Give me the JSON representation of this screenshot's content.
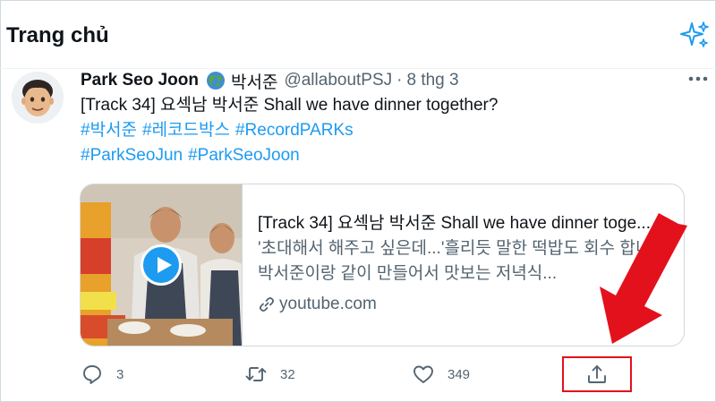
{
  "header": {
    "title": "Trang chủ",
    "sparkle_icon": "sparkle-icon"
  },
  "tweet": {
    "author_name": "Park Seo Joon",
    "author_korean": "박서준",
    "handle": "@allaboutPSJ",
    "separator": "·",
    "time": "8 thg 3",
    "text": "[Track 34] 요섹남 박서준 Shall we have dinner together?",
    "hashtags_line1": [
      "#박서준",
      "#레코드박스",
      "#RecordPARKs"
    ],
    "hashtags_line2": [
      "#ParkSeoJun",
      "#ParkSeoJoon"
    ],
    "card": {
      "title": "[Track 34] 요섹남 박서준 Shall we have dinner toge...",
      "description": "'초대해서 해주고 싶은데...'흘리듯 말한 떡밥도 회수 합니다!박서준이랑 같이 만들어서 맛보는 저녁식...",
      "domain": "youtube.com"
    },
    "actions": {
      "reply_count": "3",
      "retweet_count": "32",
      "like_count": "349"
    }
  },
  "colors": {
    "accent": "#1d9bf0",
    "highlight": "#e3111b",
    "muted": "#536471"
  }
}
